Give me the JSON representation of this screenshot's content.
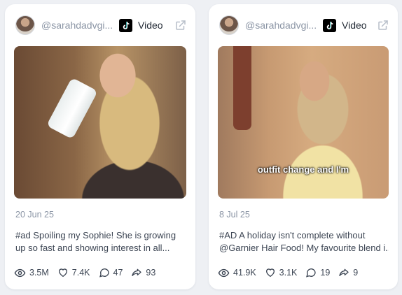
{
  "cards": [
    {
      "handle": "@sarahdadvgi...",
      "type_label": "Video",
      "platform_icon": "tiktok-icon",
      "date": "20 Jun 25",
      "description_line1": "#ad Spoiling my Sophie! She is growing",
      "description_line2": "up so fast and showing interest in all...",
      "caption": "",
      "stats": {
        "views": "3.5M",
        "likes": "7.4K",
        "comments": "47",
        "shares": "93"
      }
    },
    {
      "handle": "@sarahdadvgi...",
      "type_label": "Video",
      "platform_icon": "tiktok-icon",
      "date": "8 Jul 25",
      "description_line1": "#AD A holiday isn't complete without",
      "description_line2": "@Garnier Hair Food! My favourite blend i...",
      "caption": "outfit change and I'm",
      "stats": {
        "views": "41.9K",
        "likes": "3.1K",
        "comments": "19",
        "shares": "9"
      }
    }
  ],
  "colors": {
    "muted_text": "#8b95a5",
    "body_text": "#3d4654",
    "card_bg": "#ffffff",
    "page_bg": "#eef0f4"
  }
}
